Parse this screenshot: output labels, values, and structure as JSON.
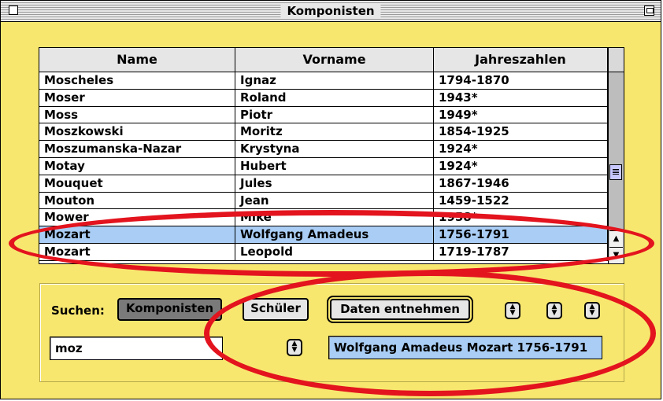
{
  "window": {
    "title": "Komponisten"
  },
  "table": {
    "columns": [
      "Name",
      "Vorname",
      "Jahreszahlen"
    ],
    "rows": [
      {
        "name": "Moscheles",
        "vorname": "Ignaz",
        "jahre": "1794-1870"
      },
      {
        "name": "Moser",
        "vorname": "Roland",
        "jahre": "1943*"
      },
      {
        "name": "Moss",
        "vorname": "Piotr",
        "jahre": "1949*"
      },
      {
        "name": "Moszkowski",
        "vorname": "Moritz",
        "jahre": "1854-1925"
      },
      {
        "name": "Moszumanska-Nazar",
        "vorname": "Krystyna",
        "jahre": "1924*"
      },
      {
        "name": "Motay",
        "vorname": "Hubert",
        "jahre": "1924*"
      },
      {
        "name": "Mouquet",
        "vorname": "Jules",
        "jahre": "1867-1946"
      },
      {
        "name": "Mouton",
        "vorname": "Jean",
        "jahre": "1459-1522"
      },
      {
        "name": "Mower",
        "vorname": "Mike",
        "jahre": "1958*"
      },
      {
        "name": "Mozart",
        "vorname": "Wolfgang Amadeus",
        "jahre": "1756-1791"
      },
      {
        "name": "Mozart",
        "vorname": "Leopold",
        "jahre": "1719-1787"
      }
    ],
    "selected_index": 9
  },
  "search": {
    "label": "Suchen:",
    "komponisten_button": "Komponisten",
    "schueler_button": "Schüler",
    "daten_button": "Daten entnehmen",
    "query": "moz",
    "result": "Wolfgang Amadeus Mozart 1756-1791"
  },
  "colors": {
    "background": "#f8e76f",
    "selection": "#a9cdf4",
    "annotation": "#e3141e"
  }
}
